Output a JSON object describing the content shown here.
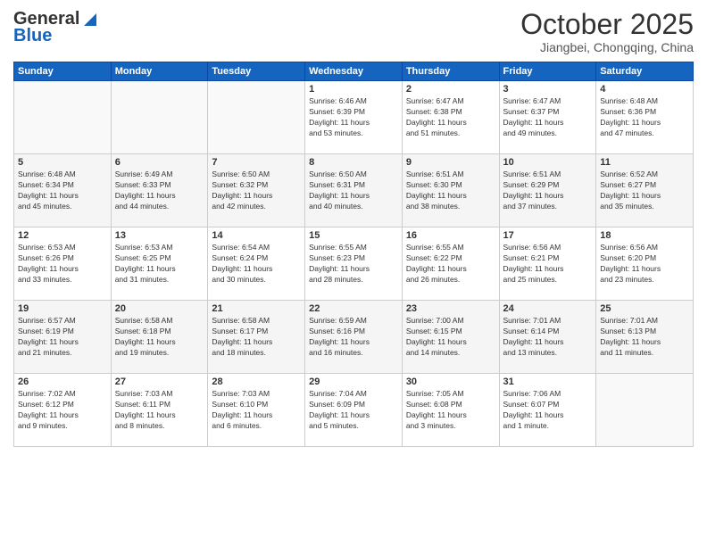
{
  "header": {
    "logo_general": "General",
    "logo_blue": "Blue",
    "month_title": "October 2025",
    "location": "Jiangbei, Chongqing, China"
  },
  "days_of_week": [
    "Sunday",
    "Monday",
    "Tuesday",
    "Wednesday",
    "Thursday",
    "Friday",
    "Saturday"
  ],
  "weeks": [
    [
      {
        "day": "",
        "info": ""
      },
      {
        "day": "",
        "info": ""
      },
      {
        "day": "",
        "info": ""
      },
      {
        "day": "1",
        "info": "Sunrise: 6:46 AM\nSunset: 6:39 PM\nDaylight: 11 hours\nand 53 minutes."
      },
      {
        "day": "2",
        "info": "Sunrise: 6:47 AM\nSunset: 6:38 PM\nDaylight: 11 hours\nand 51 minutes."
      },
      {
        "day": "3",
        "info": "Sunrise: 6:47 AM\nSunset: 6:37 PM\nDaylight: 11 hours\nand 49 minutes."
      },
      {
        "day": "4",
        "info": "Sunrise: 6:48 AM\nSunset: 6:36 PM\nDaylight: 11 hours\nand 47 minutes."
      }
    ],
    [
      {
        "day": "5",
        "info": "Sunrise: 6:48 AM\nSunset: 6:34 PM\nDaylight: 11 hours\nand 45 minutes."
      },
      {
        "day": "6",
        "info": "Sunrise: 6:49 AM\nSunset: 6:33 PM\nDaylight: 11 hours\nand 44 minutes."
      },
      {
        "day": "7",
        "info": "Sunrise: 6:50 AM\nSunset: 6:32 PM\nDaylight: 11 hours\nand 42 minutes."
      },
      {
        "day": "8",
        "info": "Sunrise: 6:50 AM\nSunset: 6:31 PM\nDaylight: 11 hours\nand 40 minutes."
      },
      {
        "day": "9",
        "info": "Sunrise: 6:51 AM\nSunset: 6:30 PM\nDaylight: 11 hours\nand 38 minutes."
      },
      {
        "day": "10",
        "info": "Sunrise: 6:51 AM\nSunset: 6:29 PM\nDaylight: 11 hours\nand 37 minutes."
      },
      {
        "day": "11",
        "info": "Sunrise: 6:52 AM\nSunset: 6:27 PM\nDaylight: 11 hours\nand 35 minutes."
      }
    ],
    [
      {
        "day": "12",
        "info": "Sunrise: 6:53 AM\nSunset: 6:26 PM\nDaylight: 11 hours\nand 33 minutes."
      },
      {
        "day": "13",
        "info": "Sunrise: 6:53 AM\nSunset: 6:25 PM\nDaylight: 11 hours\nand 31 minutes."
      },
      {
        "day": "14",
        "info": "Sunrise: 6:54 AM\nSunset: 6:24 PM\nDaylight: 11 hours\nand 30 minutes."
      },
      {
        "day": "15",
        "info": "Sunrise: 6:55 AM\nSunset: 6:23 PM\nDaylight: 11 hours\nand 28 minutes."
      },
      {
        "day": "16",
        "info": "Sunrise: 6:55 AM\nSunset: 6:22 PM\nDaylight: 11 hours\nand 26 minutes."
      },
      {
        "day": "17",
        "info": "Sunrise: 6:56 AM\nSunset: 6:21 PM\nDaylight: 11 hours\nand 25 minutes."
      },
      {
        "day": "18",
        "info": "Sunrise: 6:56 AM\nSunset: 6:20 PM\nDaylight: 11 hours\nand 23 minutes."
      }
    ],
    [
      {
        "day": "19",
        "info": "Sunrise: 6:57 AM\nSunset: 6:19 PM\nDaylight: 11 hours\nand 21 minutes."
      },
      {
        "day": "20",
        "info": "Sunrise: 6:58 AM\nSunset: 6:18 PM\nDaylight: 11 hours\nand 19 minutes."
      },
      {
        "day": "21",
        "info": "Sunrise: 6:58 AM\nSunset: 6:17 PM\nDaylight: 11 hours\nand 18 minutes."
      },
      {
        "day": "22",
        "info": "Sunrise: 6:59 AM\nSunset: 6:16 PM\nDaylight: 11 hours\nand 16 minutes."
      },
      {
        "day": "23",
        "info": "Sunrise: 7:00 AM\nSunset: 6:15 PM\nDaylight: 11 hours\nand 14 minutes."
      },
      {
        "day": "24",
        "info": "Sunrise: 7:01 AM\nSunset: 6:14 PM\nDaylight: 11 hours\nand 13 minutes."
      },
      {
        "day": "25",
        "info": "Sunrise: 7:01 AM\nSunset: 6:13 PM\nDaylight: 11 hours\nand 11 minutes."
      }
    ],
    [
      {
        "day": "26",
        "info": "Sunrise: 7:02 AM\nSunset: 6:12 PM\nDaylight: 11 hours\nand 9 minutes."
      },
      {
        "day": "27",
        "info": "Sunrise: 7:03 AM\nSunset: 6:11 PM\nDaylight: 11 hours\nand 8 minutes."
      },
      {
        "day": "28",
        "info": "Sunrise: 7:03 AM\nSunset: 6:10 PM\nDaylight: 11 hours\nand 6 minutes."
      },
      {
        "day": "29",
        "info": "Sunrise: 7:04 AM\nSunset: 6:09 PM\nDaylight: 11 hours\nand 5 minutes."
      },
      {
        "day": "30",
        "info": "Sunrise: 7:05 AM\nSunset: 6:08 PM\nDaylight: 11 hours\nand 3 minutes."
      },
      {
        "day": "31",
        "info": "Sunrise: 7:06 AM\nSunset: 6:07 PM\nDaylight: 11 hours\nand 1 minute."
      },
      {
        "day": "",
        "info": ""
      }
    ]
  ]
}
